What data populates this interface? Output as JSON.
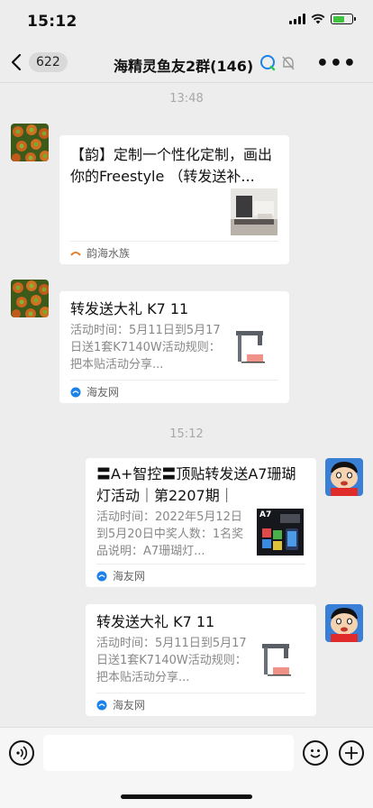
{
  "status": {
    "time": "15:12"
  },
  "nav": {
    "back_count": "622",
    "title": "海精灵鱼友2群(146)"
  },
  "messages": [
    {
      "time": "13:48",
      "title": "【韵】定制一个性化定制，画出你的Freestyle （转发送补...",
      "source": "韵海水族"
    },
    {
      "title": "转发送大礼 K7 11",
      "desc": "活动时间：5月11日到5月17日送1套K7140W活动规则：把本贴活动分享...",
      "source": "海友网"
    },
    {
      "time": "15:12",
      "title": "〓A+智控〓顶贴转发送A7珊瑚灯活动｜第2207期｜",
      "desc": "活动时间：2022年5月12日到5月20日中奖人数：1名奖品说明：A7珊瑚灯...",
      "source": "海友网",
      "thumb_label": "A7"
    },
    {
      "title": "转发送大礼 K7 11",
      "desc": "活动时间：5月11日到5月17日送1套K7140W活动规则：把本贴活动分享...",
      "source": "海友网"
    }
  ],
  "colors": {
    "background": "#ededed",
    "card": "#ffffff",
    "battery": "#3fc33f",
    "accent_blue": "#1a82e8"
  },
  "icons": [
    "voice-icon",
    "emoji-icon",
    "plus-icon",
    "more-icon",
    "back-icon",
    "wifi-icon",
    "battery-icon",
    "signal-icon",
    "mute-icon"
  ]
}
